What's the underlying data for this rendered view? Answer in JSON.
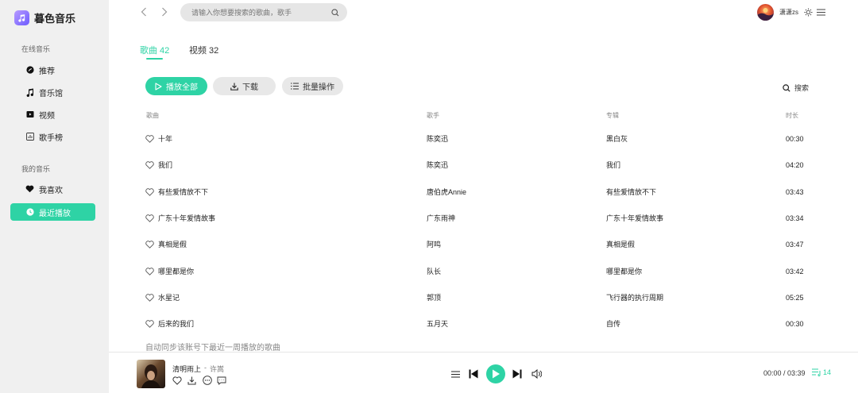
{
  "app": {
    "name": "暮色音乐",
    "accent": "#2ed3a5"
  },
  "sidebar": {
    "sections": [
      {
        "title": "在线音乐",
        "items": [
          {
            "label": "推荐",
            "icon": "recommend-icon"
          },
          {
            "label": "音乐馆",
            "icon": "music-note-icon"
          },
          {
            "label": "视频",
            "icon": "video-icon"
          },
          {
            "label": "歌手榜",
            "icon": "chart-icon"
          }
        ]
      },
      {
        "title": "我的音乐",
        "items": [
          {
            "label": "我喜欢",
            "icon": "heart-icon"
          },
          {
            "label": "最近播放",
            "icon": "clock-icon",
            "active": true
          }
        ]
      }
    ]
  },
  "topbar": {
    "search_placeholder": "请输入你想要搜索的歌曲，歌手",
    "username": "潇潇zs"
  },
  "tabs": [
    {
      "label": "歌曲 42",
      "active": true
    },
    {
      "label": "视频 32",
      "active": false
    }
  ],
  "actions": {
    "play_all": "播放全部",
    "download": "下载",
    "batch": "批量操作",
    "search": "搜索"
  },
  "table": {
    "headers": {
      "name": "歌曲",
      "artist": "歌手",
      "album": "专辑",
      "duration": "时长"
    },
    "rows": [
      {
        "name": "十年",
        "artist": "陈奕迅",
        "album": "黑白灰",
        "duration": "00:30"
      },
      {
        "name": "我们",
        "artist": "陈奕迅",
        "album": "我们",
        "duration": "04:20"
      },
      {
        "name": "有些爱情放不下",
        "artist": "唐伯虎Annie",
        "album": "有些爱情放不下",
        "duration": "03:43"
      },
      {
        "name": "广东十年爱情故事",
        "artist": "广东雨神",
        "album": "广东十年爱情故事",
        "duration": "03:34"
      },
      {
        "name": "真相是假",
        "artist": "阿鸣",
        "album": "真相是假",
        "duration": "03:47"
      },
      {
        "name": "哪里都是你",
        "artist": "队长",
        "album": "哪里都是你",
        "duration": "03:42"
      },
      {
        "name": "水星记",
        "artist": "郭顶",
        "album": "飞行器的执行周期",
        "duration": "05:25"
      },
      {
        "name": "后来的我们",
        "artist": "五月天",
        "album": "自传",
        "duration": "00:30"
      }
    ],
    "footnote": "自动同步该账号下最近一周播放的歌曲"
  },
  "player": {
    "title": "清明雨上",
    "separator": "-",
    "artist": "许嵩",
    "time": "00:00 / 03:39",
    "queue_count": "14"
  }
}
